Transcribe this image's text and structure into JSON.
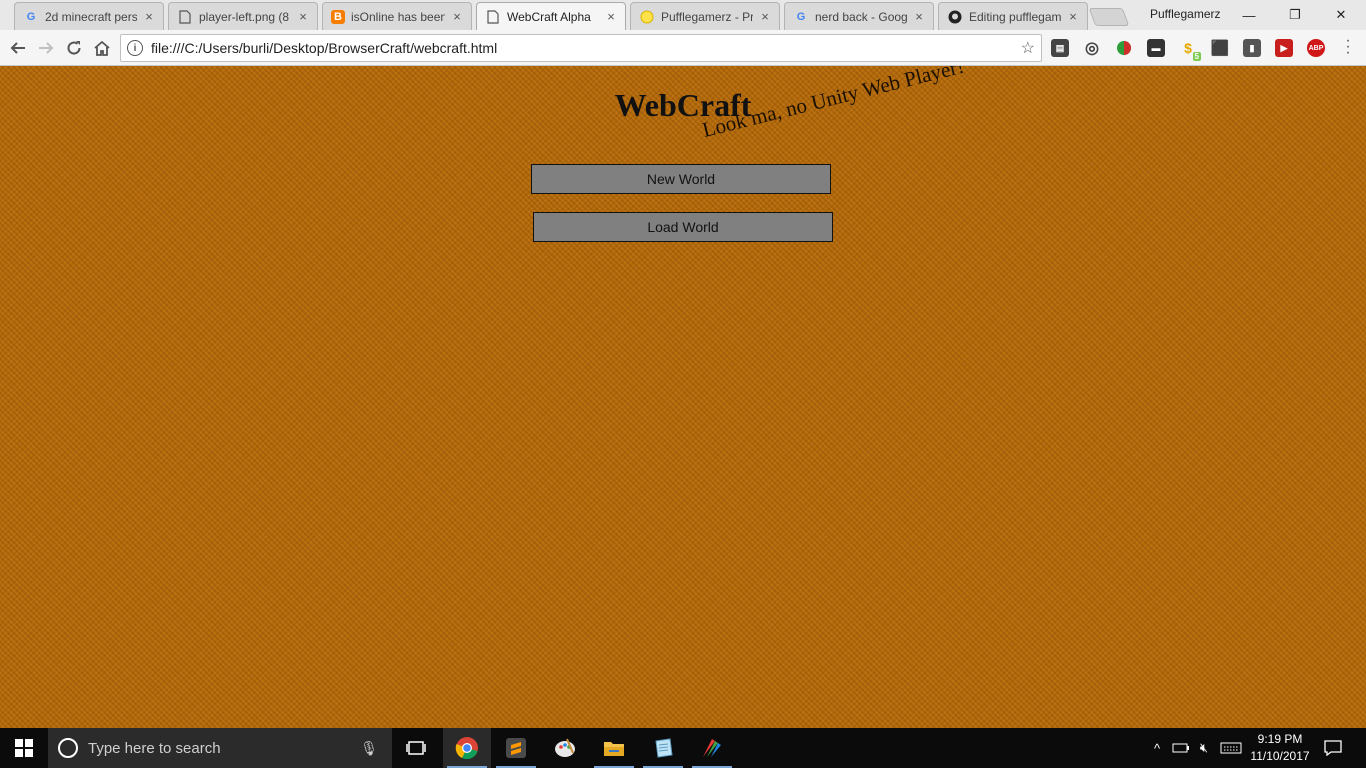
{
  "browser": {
    "tabs": [
      {
        "title": "2d minecraft pers",
        "icon": "google-icon"
      },
      {
        "title": "player-left.png (8",
        "icon": "file-icon"
      },
      {
        "title": "isOnline has been",
        "icon": "blogger-icon"
      },
      {
        "title": "WebCraft Alpha",
        "icon": "file-icon",
        "active": true
      },
      {
        "title": "Pufflegamerz - Pr",
        "icon": "smiley-icon"
      },
      {
        "title": "nerd back - Goog",
        "icon": "google-icon"
      },
      {
        "title": "Editing pufflegam",
        "icon": "github-icon"
      }
    ],
    "profile_name": "Pufflegamerz",
    "window_controls": {
      "minimize": "—",
      "restore": "❐",
      "close": "✕"
    },
    "url": "file:///C:/Users/burli/Desktop/BrowserCraft/webcraft.html",
    "extensions": [
      "film-icon",
      "aperture-icon",
      "ball-icon",
      "tab-icon",
      "dollar-icon",
      "camera-icon",
      "doc-icon",
      "play-icon",
      "adblock-icon"
    ],
    "extension_badges": {
      "dollar": "5",
      "adblock": "ABP"
    }
  },
  "page": {
    "title": "WebCraft",
    "splash": "Look ma, no Unity Web Player!",
    "buttons": {
      "new_world": "New World",
      "load_world": "Load World"
    },
    "background_color": "#b5690a"
  },
  "taskbar": {
    "search_placeholder": "Type here to search",
    "time": "9:19 PM",
    "date": "11/10/2017",
    "apps": [
      "chrome-icon",
      "sublime-icon",
      "paint-icon",
      "file-explorer-icon",
      "notepad-icon",
      "brush-app-icon"
    ]
  }
}
